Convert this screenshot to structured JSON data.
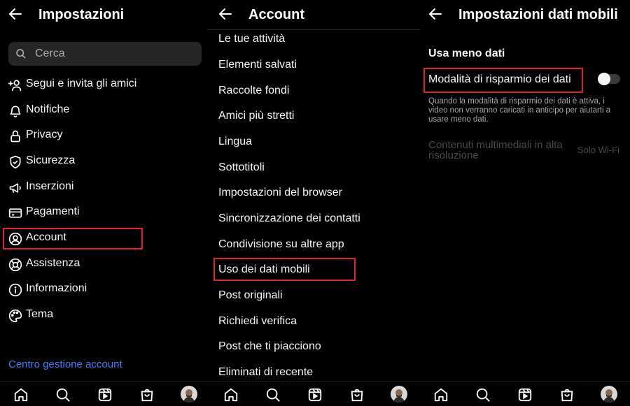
{
  "panel1": {
    "title": "Impostazioni",
    "search_placeholder": "Cerca",
    "items": [
      {
        "label": "Segui e invita gli amici",
        "icon": "add-person-icon"
      },
      {
        "label": "Notifiche",
        "icon": "bell-icon"
      },
      {
        "label": "Privacy",
        "icon": "lock-icon"
      },
      {
        "label": "Sicurezza",
        "icon": "shield-icon"
      },
      {
        "label": "Inserzioni",
        "icon": "megaphone-icon"
      },
      {
        "label": "Pagamenti",
        "icon": "card-icon"
      },
      {
        "label": "Account",
        "icon": "user-circle-icon"
      },
      {
        "label": "Assistenza",
        "icon": "lifebuoy-icon"
      },
      {
        "label": "Informazioni",
        "icon": "info-icon"
      },
      {
        "label": "Tema",
        "icon": "palette-icon"
      }
    ],
    "link": "Centro gestione account"
  },
  "panel2": {
    "title": "Account",
    "items": [
      "Le tue attività",
      "Elementi salvati",
      "Raccolte fondi",
      "Amici più stretti",
      "Lingua",
      "Sottotitoli",
      "Impostazioni del browser",
      "Sincronizzazione dei contatti",
      "Condivisione su altre app",
      "Uso dei dati mobili",
      "Post originali",
      "Richiedi verifica",
      "Post che ti piacciono",
      "Eliminati di recente"
    ]
  },
  "panel3": {
    "title": "Impostazioni dati mobili",
    "section": "Usa meno dati",
    "toggle_label": "Modalità di risparmio dei dati",
    "toggle_on": false,
    "description": "Quando la modalità di risparmio dei dati è attiva, i video non verranno caricati in anticipo per aiutarti a usare meno dati.",
    "hires_label": "Contenuti multimediali in alta risoluzione",
    "hires_value": "Solo Wi-Fi"
  },
  "nav_icons": [
    "home-icon",
    "search-icon",
    "reels-icon",
    "shop-icon",
    "profile-avatar"
  ],
  "colors": {
    "background": "#000000",
    "highlight": "#e02424",
    "link": "#3b82f6",
    "muted": "#a8a8a8"
  }
}
